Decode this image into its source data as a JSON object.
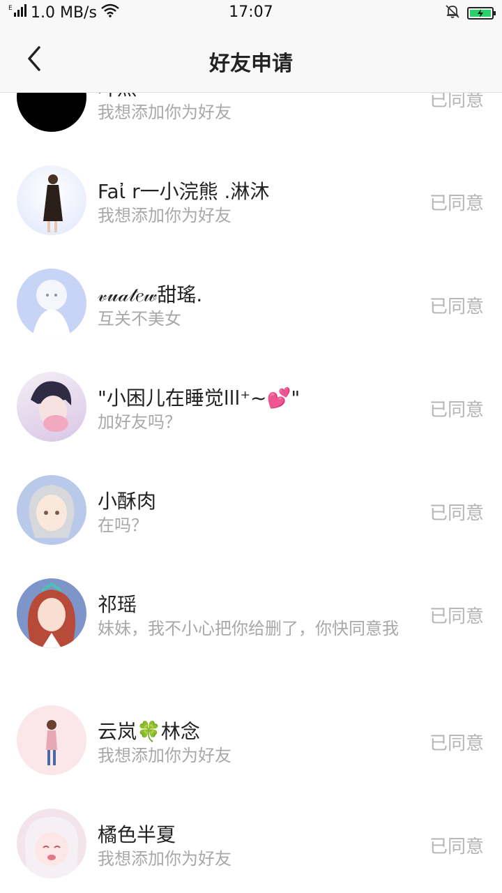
{
  "status_bar": {
    "signal": "E",
    "speed": "1.0 MB/s",
    "time": "17:07"
  },
  "header": {
    "title": "好友申请"
  },
  "requests": [
    {
      "name": "叶煕",
      "message": "我想添加你为好友",
      "status": "已同意",
      "avatar_color": "#000000"
    },
    {
      "name": "Faἰ r一小浣熊 .淋沐",
      "message": "我想添加你为好友",
      "status": "已同意",
      "avatar_color": "#dfe6fb"
    },
    {
      "name": "𝓋𝓊𝒶𝓉𝑒𝓌甜瑤.",
      "message": "互关不美女",
      "status": "已同意",
      "avatar_color": "#c8d4f6"
    },
    {
      "name": "\"小困儿在睡觉lll⁺~💕\"",
      "message": "加好友吗？",
      "status": "已同意",
      "avatar_color": "#e8d8ec"
    },
    {
      "name": "小酥肉",
      "message": "在吗？",
      "status": "已同意",
      "avatar_color": "#b9c9ea"
    },
    {
      "name": "祁瑶",
      "message": "妹妹，我不小心把你给删了，你快同意我",
      "status": "已同意",
      "avatar_color": "#7d95c9"
    },
    {
      "name": "云岚🍀林念",
      "message": "我想添加你为好友",
      "status": "已同意",
      "avatar_color": "#fbe6ea"
    },
    {
      "name": "橘色半夏",
      "message": "我想添加你为好友",
      "status": "已同意",
      "avatar_color": "#f2e4ea"
    }
  ]
}
